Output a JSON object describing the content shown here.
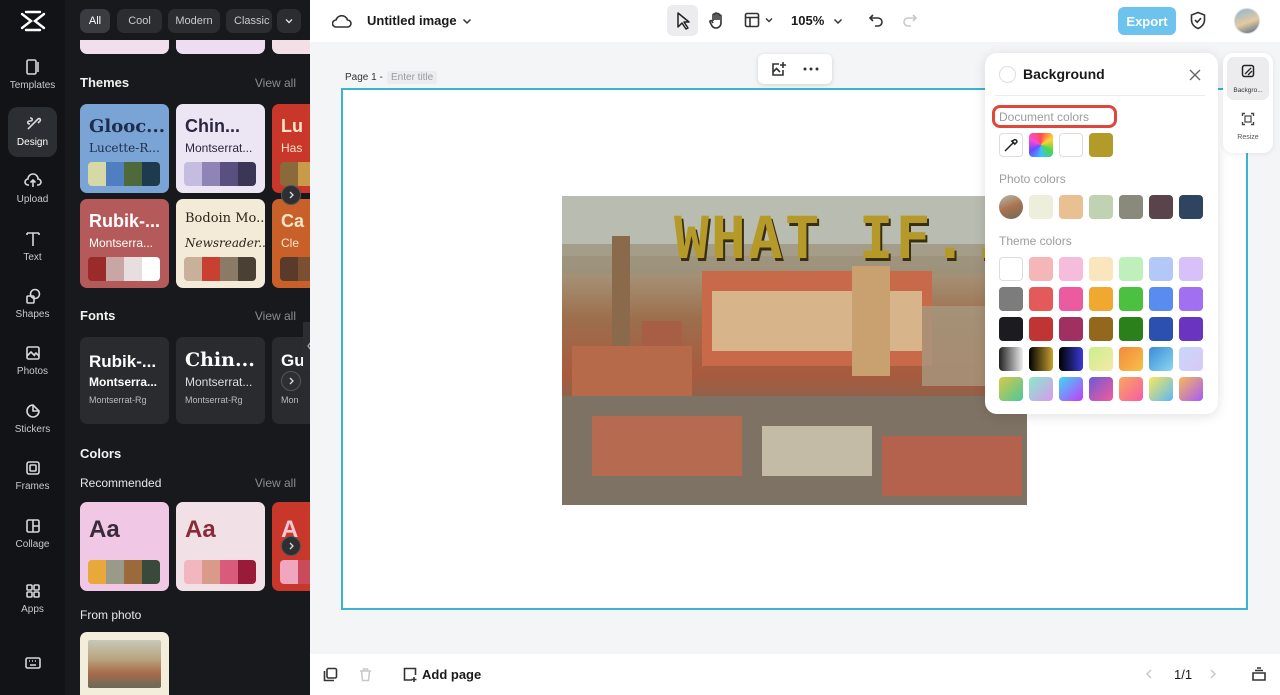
{
  "rail": {
    "items": [
      {
        "label": "Templates",
        "icon": "templates-icon"
      },
      {
        "label": "Design",
        "icon": "design-icon"
      },
      {
        "label": "Upload",
        "icon": "upload-icon"
      },
      {
        "label": "Text",
        "icon": "text-icon"
      },
      {
        "label": "Shapes",
        "icon": "shapes-icon"
      },
      {
        "label": "Photos",
        "icon": "photos-icon"
      },
      {
        "label": "Stickers",
        "icon": "stickers-icon"
      },
      {
        "label": "Frames",
        "icon": "frames-icon"
      },
      {
        "label": "Collage",
        "icon": "collage-icon"
      },
      {
        "label": "Apps",
        "icon": "apps-icon"
      }
    ]
  },
  "panel": {
    "chips": [
      "All",
      "Cool",
      "Modern",
      "Classic"
    ],
    "themes": {
      "title": "Themes",
      "view_all": "View all",
      "cards": [
        {
          "t1": "Glooc...",
          "t2": "Lucette-R...",
          "bg": "#7aa3d6",
          "fg": "#1d2d4a",
          "colors": [
            "#d6d9a6",
            "#4f7ec1",
            "#4f6a3a",
            "#1e3a4d"
          ]
        },
        {
          "t1": "Chin...",
          "t2": "Montserrat...",
          "bg": "#ece6f4",
          "fg": "#2c2740",
          "colors": [
            "#c5bde0",
            "#8e84b6",
            "#5a5080",
            "#3b3556"
          ]
        },
        {
          "t1": "Lu",
          "t2": "Has",
          "bg": "#c9362a",
          "fg": "#f5e6c8",
          "colors": [
            "#8a6a3a",
            "#c99a4a",
            "#333",
            "#555"
          ]
        },
        {
          "t1": "Rubik-...",
          "t2": "Montserra...",
          "bg": "#b45a5a",
          "fg": "#ffffff",
          "colors": [
            "#9b2a2a",
            "#c9a6a6",
            "#e8dede",
            "#ffffff"
          ]
        },
        {
          "t1": "Bodoin Mo...",
          "t2": "Newsreader...",
          "bg": "#f4ead8",
          "fg": "#2b2418",
          "colors": [
            "#c9b09a",
            "#c94030",
            "#8a7a66",
            "#4a4034"
          ]
        },
        {
          "t1": "Ca",
          "t2": "Cle",
          "bg": "#c9602a",
          "fg": "#f5e6c8",
          "colors": [
            "#5a3a2a",
            "#7a5030",
            "#333",
            "#555"
          ]
        }
      ]
    },
    "fonts": {
      "title": "Fonts",
      "view_all": "View all",
      "cards": [
        {
          "t1": "Rubik-...",
          "t2": "Montserra...",
          "t3": "Montserrat-Rg"
        },
        {
          "t1": "Chin...",
          "t2": "Montserrat...",
          "t3": "Montserrat-Rg"
        },
        {
          "t1": "Gu",
          "t2": "",
          "t3": "Mon"
        }
      ]
    },
    "colors": {
      "title": "Colors",
      "recommended": "Recommended",
      "view_all": "View all",
      "cards": [
        {
          "aa": "Aa",
          "bg": "#f1c7e6",
          "fg": "#3a2a3a",
          "colors": [
            "#e8a83a",
            "#9a9a8a",
            "#9a6a3a",
            "#3a4a3a"
          ]
        },
        {
          "aa": "Aa",
          "bg": "#f1e1e6",
          "fg": "#8a2a3a",
          "colors": [
            "#f1b6c0",
            "#d99a8a",
            "#d95a7a",
            "#9a1a3a"
          ]
        },
        {
          "aa": "A",
          "bg": "#c9362a",
          "fg": "#f1c7d6",
          "colors": [
            "#f1a6c0",
            "#c94a5a",
            "#333",
            "#555"
          ]
        }
      ],
      "from_photo": "From photo"
    }
  },
  "topbar": {
    "title": "Untitled image",
    "zoom": "105%",
    "export": "Export"
  },
  "canvas": {
    "page_label": "Page 1 -",
    "title_placeholder": "Enter title",
    "overlay_text": "WHAT IF..",
    "page_count": "1/1"
  },
  "bottombar": {
    "add_page": "Add page"
  },
  "background_panel": {
    "title": "Background",
    "document_colors_label": "Document colors",
    "photo_colors_label": "Photo colors",
    "theme_colors_label": "Theme colors",
    "document_colors": [
      "#ffffff",
      "#b39b2a"
    ],
    "photo_colors": [
      "#eeeedd",
      "#e8c092",
      "#c1d2b2",
      "#8a8a7c",
      "#5a444c",
      "#2e4460"
    ],
    "theme_colors": [
      [
        "#ffffff",
        "#f4b6b6",
        "#f6bcdc",
        "#fae6bc",
        "#bff0bc",
        "#b4c8f8",
        "#d8c0f8"
      ],
      [
        "#7c7c7c",
        "#e45a5a",
        "#ec5aa0",
        "#f0a830",
        "#4cc040",
        "#5a8cf0",
        "#a070f0"
      ],
      [
        "#1c1c20",
        "#c03434",
        "#a03060",
        "#94681c",
        "#2c801c",
        "#2c50b0",
        "#6a34c0"
      ]
    ]
  },
  "rightdock": {
    "background_label": "Backgro...",
    "resize_label": "Resize"
  },
  "accent_colors": {
    "export": "#6cc3ee",
    "canvas_border": "#3ab4d0",
    "highlight": "#e0463a"
  }
}
